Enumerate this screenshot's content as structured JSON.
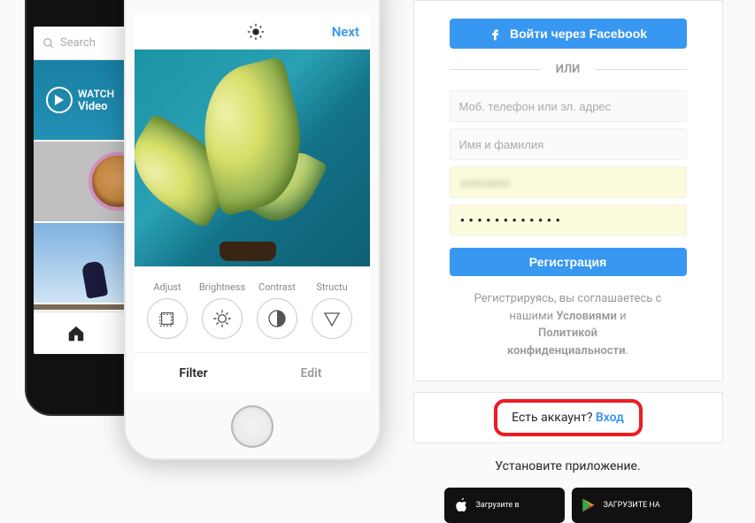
{
  "phone_back": {
    "search_placeholder": "Search",
    "watch_label": "WATCH",
    "video_label": "Video"
  },
  "editor": {
    "next_label": "Next",
    "tools": {
      "adjust": "Adjust",
      "brightness": "Brightness",
      "contrast": "Contrast",
      "structure": "Structu"
    },
    "tab_filter": "Filter",
    "tab_edit": "Edit"
  },
  "signup": {
    "fb_label": "Войти через Facebook",
    "divider": "ИЛИ",
    "ph_phone": "Моб. телефон или эл. адрес",
    "ph_name": "Имя и фамилия",
    "username_value": "username",
    "password_value": "••••••••••••",
    "submit": "Регистрация",
    "terms_line1": "Регистрируясь, вы соглашаетесь с",
    "terms_line2_a": "нашими ",
    "terms_line2_b": "Условиями",
    "terms_line2_c": " и",
    "terms_line3": "Политикой",
    "terms_line4": "конфиденциальности"
  },
  "login": {
    "have_account": "Есть аккаунт? ",
    "login_link": "Вход"
  },
  "install": {
    "text": "Установите приложение.",
    "appstore": "Загрузите в",
    "gplay": "ЗАГРУЗИТЕ НА"
  }
}
